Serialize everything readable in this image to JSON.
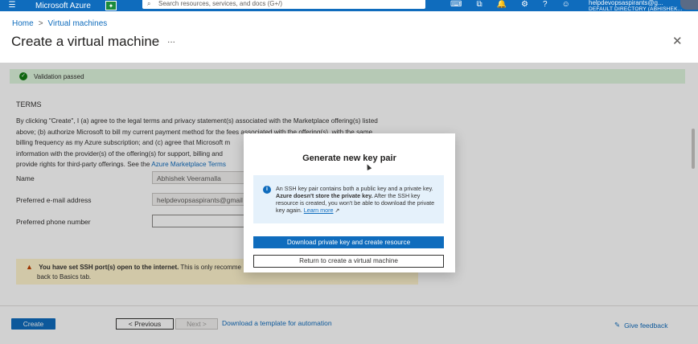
{
  "topbar": {
    "brand": "Microsoft Azure",
    "search_placeholder": "Search resources, services, and docs (G+/)",
    "account_email": "helpdevopsaspirants@g...",
    "account_directory": "DEFAULT DIRECTORY (ABHISHEK..."
  },
  "breadcrumb": {
    "home": "Home",
    "sep": ">",
    "vms": "Virtual machines"
  },
  "page": {
    "title": "Create a virtual machine",
    "more": "...",
    "close": "✕"
  },
  "validation": {
    "text": "Validation passed"
  },
  "terms": {
    "title": "TERMS",
    "line1": "By clicking \"Create\", I (a) agree to the legal terms and privacy statement(s) associated with the Marketplace offering(s) listed",
    "line2": "above; (b) authorize Microsoft to bill my current payment method for the fees associated with the offering(s), with the same",
    "line3": "billing frequency as my Azure subscription; and (c) agree that Microsoft m",
    "line4": "information with the provider(s) of the offering(s) for support, billing and",
    "line5": "provide rights for third-party offerings. See the",
    "line5_link": "Azure Marketplace Terms"
  },
  "fields": {
    "name_label": "Name",
    "name_value": "Abhishek Veeramalla",
    "email_label": "Preferred e-mail address",
    "email_value": "helpdevopsaspirants@gmail",
    "phone_label": "Preferred phone number",
    "phone_value": ""
  },
  "warning": {
    "bold": "You have set SSH port(s) open to the internet.",
    "text": "This is only recomme",
    "line2": "back to Basics tab."
  },
  "footer": {
    "create": "Create",
    "previous": "< Previous",
    "next": "Next >",
    "download_template": "Download a template for automation",
    "feedback": "Give feedback"
  },
  "modal": {
    "title": "Generate new key pair",
    "info_part1": "An SSH key pair contains both a public key and a private key.",
    "info_bold": "Azure doesn't store the private key.",
    "info_part2": "After the SSH key resource is created, you won't be able to download the private key again.",
    "learn_more": "Learn more",
    "primary_button": "Download private key and create resource",
    "secondary_button": "Return to create a virtual machine"
  },
  "colors": {
    "accent": "#0f6cbd",
    "success": "#107c10",
    "warning_bg": "#fff4ce",
    "info_bg": "#e5f1fb"
  },
  "icons": {
    "menu": "hamburger-icon",
    "search": "search-icon",
    "check": "check-circle-icon",
    "warning": "warning-icon",
    "info": "info-icon",
    "feedback": "feedback-icon",
    "close": "close-icon"
  }
}
